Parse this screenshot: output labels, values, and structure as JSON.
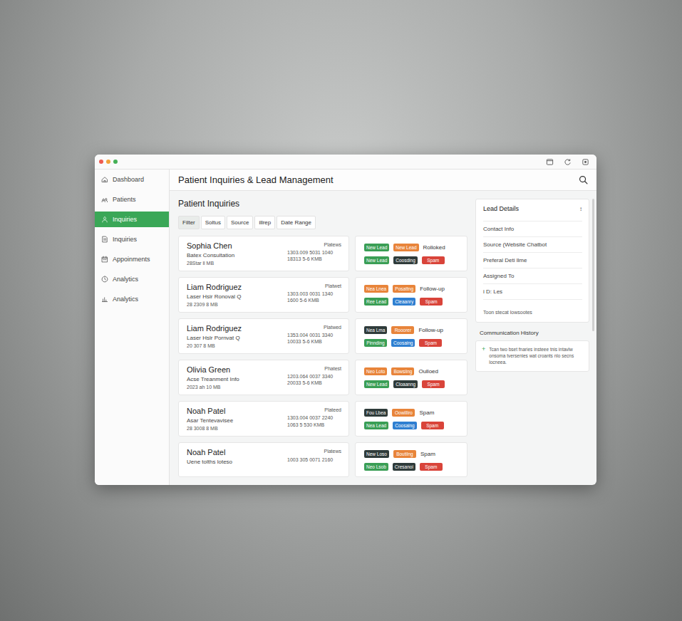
{
  "window": {
    "title": "Patient Inquiries & Lead Management"
  },
  "sidebar": {
    "items": [
      {
        "label": "Dashboard",
        "selected": false
      },
      {
        "label": "Patients",
        "selected": false
      },
      {
        "label": "Inquiries",
        "selected": true
      },
      {
        "label": "Inquiries",
        "selected": false
      },
      {
        "label": "Appoinments",
        "selected": false
      },
      {
        "label": "Analytics",
        "selected": false
      },
      {
        "label": "Analytics",
        "selected": false
      }
    ]
  },
  "section_title": "Patient Inquiries",
  "filters": [
    {
      "label": "Filter",
      "selected": true
    },
    {
      "label": "Soltus",
      "selected": false
    },
    {
      "label": "Source",
      "selected": false
    },
    {
      "label": "illrep",
      "selected": false
    },
    {
      "label": "Date Range",
      "selected": false
    }
  ],
  "inquiries": [
    {
      "name": "Sophia Chen",
      "service": "Batex Consultation",
      "date": "28Star ll MB",
      "source": "Platews",
      "phone": "1303.009 5031 1040",
      "code": "18313 5-6 KMB",
      "tags_top": [
        {
          "label": "New Lead",
          "color": "#3a9e55"
        },
        {
          "label": "New Lead",
          "color": "#e8843a"
        }
      ],
      "status": "Rolloked",
      "tags_bottom": [
        {
          "label": "New Lead",
          "color": "#3a9e55"
        },
        {
          "label": "Coosding",
          "color": "#2f3b3a"
        },
        {
          "label": "Spam",
          "color": "#d9443a"
        }
      ]
    },
    {
      "name": "Liam Rodriguez",
      "service": "Laser Hsir Ronoval Q",
      "date": "28 2309 8 MB",
      "source": "Platwet",
      "phone": "1303.003 0031 1340",
      "code": "1600 5-6 KMB",
      "tags_top": [
        {
          "label": "Nea Lnea",
          "color": "#e8843a"
        },
        {
          "label": "Posattng",
          "color": "#e8843a"
        }
      ],
      "status": "Follow-up",
      "tags_bottom": [
        {
          "label": "Ree Lead",
          "color": "#3a9e55"
        },
        {
          "label": "Cleaanry",
          "color": "#2f7fd1"
        },
        {
          "label": "Spam",
          "color": "#d9443a"
        }
      ]
    },
    {
      "name": "Liam Rodriguez",
      "service": "Laser Hslr Pornvat Q",
      "date": "20 307 8 MB",
      "source": "Platwed",
      "phone": "1353.004 0031 3340",
      "code": "10033 5-6 KMB",
      "tags_top": [
        {
          "label": "Nea Lma",
          "color": "#2f3b3a"
        },
        {
          "label": "Rooorer",
          "color": "#e8843a"
        }
      ],
      "status": "Follow-up",
      "tags_bottom": [
        {
          "label": "Pinnding",
          "color": "#3a9e55"
        },
        {
          "label": "Coosaing",
          "color": "#2f7fd1"
        },
        {
          "label": "Spam",
          "color": "#d9443a"
        }
      ]
    },
    {
      "name": "Olivia Green",
      "service": "Acse Treanment Info",
      "date": "2023 ah 10 MB",
      "source": "Phatest",
      "phone": "1203.064 0037 3340",
      "code": "20033 5-6 KMB",
      "tags_top": [
        {
          "label": "Neo Loto",
          "color": "#e8843a"
        },
        {
          "label": "Bowsiing",
          "color": "#e8843a"
        }
      ],
      "status": "Oulloed",
      "tags_bottom": [
        {
          "label": "New Lead",
          "color": "#3a9e55"
        },
        {
          "label": "Cloaanng",
          "color": "#2f3b3a"
        },
        {
          "label": "Spam",
          "color": "#d9443a"
        }
      ]
    },
    {
      "name": "Noah Patel",
      "service": "Asar Tentevavisee",
      "date": "28 3008 8 MB",
      "source": "Plateed",
      "phone": "1303.004 0037 2240",
      "code": "1063 5 530 KMB",
      "tags_top": [
        {
          "label": "Fou Lbea",
          "color": "#2f3b3a"
        },
        {
          "label": "Oowilliro",
          "color": "#e8843a"
        }
      ],
      "status": "Spam",
      "tags_bottom": [
        {
          "label": "Nea Lead",
          "color": "#3a9e55"
        },
        {
          "label": "Coosaing",
          "color": "#2f7fd1"
        },
        {
          "label": "Spam",
          "color": "#d9443a"
        }
      ]
    },
    {
      "name": "Noah Patel",
      "service": "Uene tolths loteso",
      "source": "Platews",
      "phone": "1003 305 0071 2160",
      "tags_top": [
        {
          "label": "New Loso",
          "color": "#2f3b3a"
        },
        {
          "label": "Boutilng",
          "color": "#e8843a"
        }
      ],
      "status": "Spam",
      "tags_bottom": [
        {
          "label": "Neo Lsob",
          "color": "#3a9e55"
        },
        {
          "label": "Cresanoi",
          "color": "#2f3b3a"
        },
        {
          "label": "Spam",
          "color": "#d9443a"
        }
      ]
    }
  ],
  "lead_details": {
    "title": "Lead Details",
    "toggle": "↕",
    "fields": [
      "Contact Info",
      "Source (Website Chatbot",
      "Preferal Deti llme",
      "Assigned To",
      "i D: Les"
    ],
    "note": "Toon stecat lowsootes"
  },
  "communication_history": {
    "title": "Communication History",
    "entries": [
      {
        "icon": "+",
        "text": "Tcan two bset fnaries insteee tnis intavlw onsoma tversenies wat croants nlo secns locneea."
      }
    ]
  }
}
